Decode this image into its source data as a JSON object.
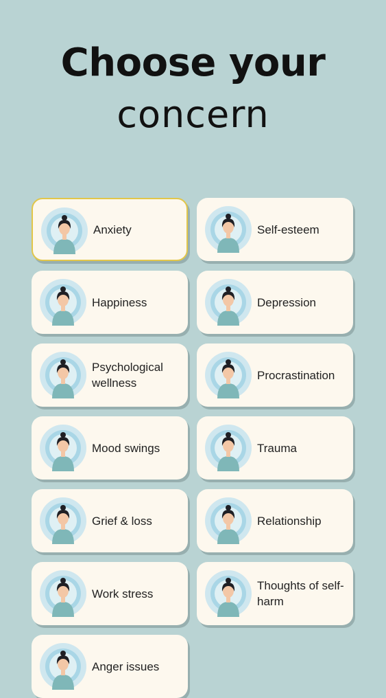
{
  "header": {
    "title_line1": "Choose your",
    "title_line2": "concern"
  },
  "colors": {
    "background": "#b9d3d3",
    "card": "#fdf8ee",
    "selected_border": "#e1c64a",
    "avatar_ring_outer": "#cfe7ef",
    "avatar_ring_inner": "#a9d6e6",
    "figure_body": "#7fb7b8",
    "hair": "#1f1f24"
  },
  "concerns": [
    {
      "label": "Anxiety",
      "icon": "anxiety-icon",
      "selected": true
    },
    {
      "label": "Self-esteem",
      "icon": "self-esteem-icon",
      "selected": false
    },
    {
      "label": "Happiness",
      "icon": "happiness-icon",
      "selected": false
    },
    {
      "label": "Depression",
      "icon": "depression-icon",
      "selected": false
    },
    {
      "label": "Psychological wellness",
      "icon": "psychological-wellness-icon",
      "selected": false
    },
    {
      "label": "Procrastination",
      "icon": "procrastination-icon",
      "selected": false
    },
    {
      "label": "Mood swings",
      "icon": "mood-swings-icon",
      "selected": false
    },
    {
      "label": "Trauma",
      "icon": "trauma-icon",
      "selected": false
    },
    {
      "label": "Grief & loss",
      "icon": "grief-loss-icon",
      "selected": false
    },
    {
      "label": "Relationship",
      "icon": "relationship-icon",
      "selected": false
    },
    {
      "label": "Work stress",
      "icon": "work-stress-icon",
      "selected": false
    },
    {
      "label": "Thoughts of self-harm",
      "icon": "thoughts-of-self-harm-icon",
      "selected": false
    },
    {
      "label": "Anger issues",
      "icon": "anger-issues-icon",
      "selected": false
    }
  ]
}
